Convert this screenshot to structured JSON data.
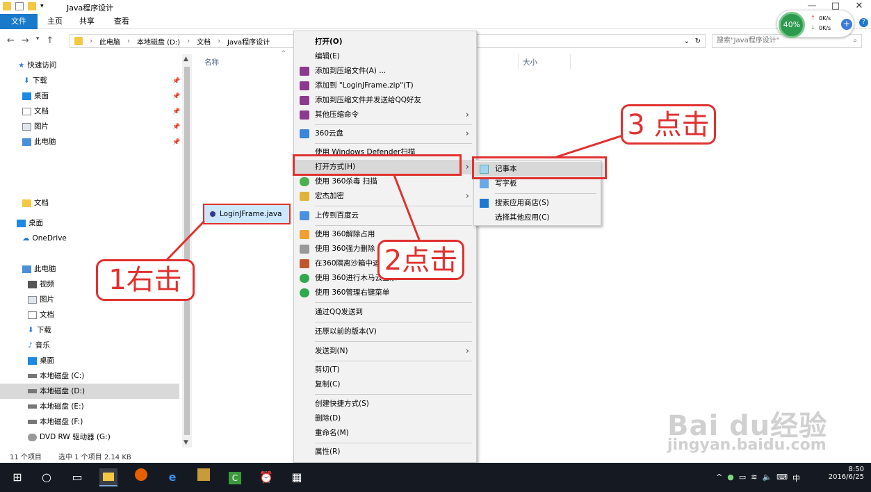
{
  "window": {
    "title": "Java程序设计",
    "controls": [
      "—",
      "□",
      "✕"
    ]
  },
  "ribbon": {
    "tabs": [
      "文件",
      "主页",
      "共享",
      "查看"
    ]
  },
  "address": {
    "path": [
      "此电脑",
      "本地磁盘 (D:)",
      "文档",
      "Java程序设计"
    ],
    "search_placeholder": "搜索\"Java程序设计\""
  },
  "nav": {
    "quick_access": "快速访问",
    "quick_items": [
      "下载",
      "桌面",
      "文档",
      "图片",
      "此电脑"
    ],
    "docs": "文档",
    "desktop": "桌面",
    "onedrive": "OneDrive",
    "this_pc": "此电脑",
    "pc_items": [
      "视频",
      "图片",
      "文档",
      "下载",
      "音乐",
      "桌面",
      "本地磁盘 (C:)",
      "本地磁盘 (D:)",
      "本地磁盘 (E:)",
      "本地磁盘 (F:)",
      "DVD RW 驱动器 (G:)"
    ]
  },
  "columns": {
    "name": "名称",
    "size": "大小"
  },
  "file": {
    "name": "LoginJFrame.java"
  },
  "status": {
    "count": "11 个项目",
    "selection": "选中 1 个项目  2.14 KB"
  },
  "context_menu": {
    "items": [
      "打开(O)",
      "编辑(E)",
      "添加到压缩文件(A) ...",
      "添加到 \"LoginJFrame.zip\"(T)",
      "添加到压缩文件并发送给QQ好友",
      "其他压缩命令",
      "360云盘",
      "使用 Windows Defender扫描",
      "打开方式(H)",
      "使用 360杀毒 扫描",
      "宏杰加密",
      "上传到百度云",
      "使用 360解除占用",
      "使用 360强力删除",
      "在360隔离沙箱中运行",
      "使用 360进行木马云查杀",
      "使用 360管理右键菜单",
      "通过QQ发送到",
      "还原以前的版本(V)",
      "发送到(N)",
      "剪切(T)",
      "复制(C)",
      "创建快捷方式(S)",
      "删除(D)",
      "重命名(M)",
      "属性(R)"
    ]
  },
  "submenu": {
    "items": [
      "记事本",
      "写字板",
      "搜索应用商店(S)",
      "选择其他应用(C)"
    ]
  },
  "annotations": {
    "step1": "1右击",
    "step2": "2点击",
    "step3": "3 点击"
  },
  "net_widget": {
    "percent": "40%",
    "up": "0K/s",
    "down": "0K/s"
  },
  "taskbar": {
    "time": "8:50",
    "date": "2016/6/25",
    "ime": "中"
  },
  "watermark": {
    "brand": "Bai du经验",
    "url": "jingyan.baidu.com"
  },
  "colors": {
    "accent": "#1979ca",
    "annotation_red": "#e0312f",
    "selection": "#cce8ff"
  }
}
